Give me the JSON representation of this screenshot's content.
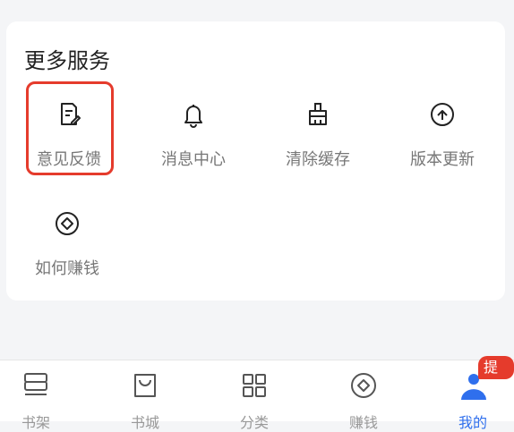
{
  "section": {
    "title": "更多服务"
  },
  "services": [
    {
      "label": "意见反馈",
      "icon": "feedback-icon"
    },
    {
      "label": "消息中心",
      "icon": "bell-icon"
    },
    {
      "label": "清除缓存",
      "icon": "broom-icon"
    },
    {
      "label": "版本更新",
      "icon": "cloud-upload-icon"
    },
    {
      "label": "如何赚钱",
      "icon": "diamond-circle-icon"
    }
  ],
  "tabbar": {
    "tabs": [
      {
        "label": "书架",
        "icon": "bookshelf-icon"
      },
      {
        "label": "书城",
        "icon": "store-bag-icon"
      },
      {
        "label": "分类",
        "icon": "grid-icon"
      },
      {
        "label": "赚钱",
        "icon": "diamond-circle-icon"
      },
      {
        "label": "我的",
        "icon": "person-icon"
      }
    ],
    "badge": "提现"
  },
  "colors": {
    "accent": "#2f6fed",
    "highlight": "#e53b2c"
  }
}
